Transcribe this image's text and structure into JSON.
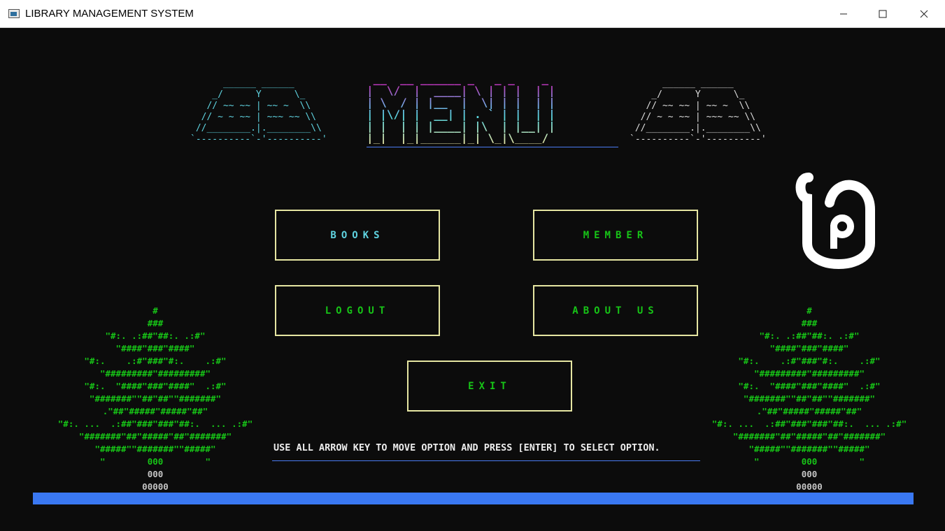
{
  "window": {
    "title": "LIBRARY MANAGEMENT SYSTEM"
  },
  "header": {
    "book_art_left": "      ______ ______\n    _/      Y      \\_\n   // ~~ ~~ | ~~ ~  \\\\\n  // ~ ~ ~~ | ~~~ ~~ \\\\\n //________.|.________\\\\\n`----------`-'----------'",
    "menu_art": " __  __ ______ _   _ _    _\n|  \\/  |  ____| \\ | | |  | |\n| \\  / | |__  |  \\| | |  | |\n| |\\/| |  __| | . ` | |  | |\n| |  | | |____| |\\  | |__| |\n|_|  |_|______|_| \\_|\\____/",
    "book_art_right": "      ______ ______\n    _/      Y      \\_\n   // ~~ ~~ | ~~ ~  \\\\\n  // ~ ~ ~~ | ~~~ ~~ \\\\\n //________.|.________\\\\\n`----------`-'----------'"
  },
  "menu": {
    "books": "BOOKS",
    "member": "MEMBER",
    "logout": "LOGOUT",
    "about_us": "ABOUT US",
    "exit": "EXIT"
  },
  "tree": {
    "foliage": "#\n###\n\"#:. .:##\"##:. .:#\"\n\"####\"###\"####\"\n\"#:.    .:#\"###\"#:.    .:#\"\n\"#########\"#########\"\n\"#:.  \"####\"###\"####\"  .:#\"\n\"#######\"\"##\"##\"\"#######\"\n.\"##\"#####\"#####\"##\"\n\"#:. ...  .:##\"###\"###\"##:.  ... .:#\"\n\"#######\"##\"#####\"##\"#######\"\n\"#####\"\"#######\"\"#####\"\n\"        000        \"",
    "trunk": "000\n00000"
  },
  "instruction": "USE ALL ARROW KEY TO MOVE OPTION AND PRESS [ENTER] TO SELECT OPTION.",
  "progress": {
    "value": 1.0
  },
  "colors": {
    "button_border": "#e6e6a2",
    "books_text": "#5fd3e0",
    "other_text": "#17c417",
    "progress_bar": "#3a78f2",
    "tree": "#17c417",
    "background": "#0c0c0c"
  },
  "icons": {
    "logo": "lao-glyph-logo-icon"
  }
}
